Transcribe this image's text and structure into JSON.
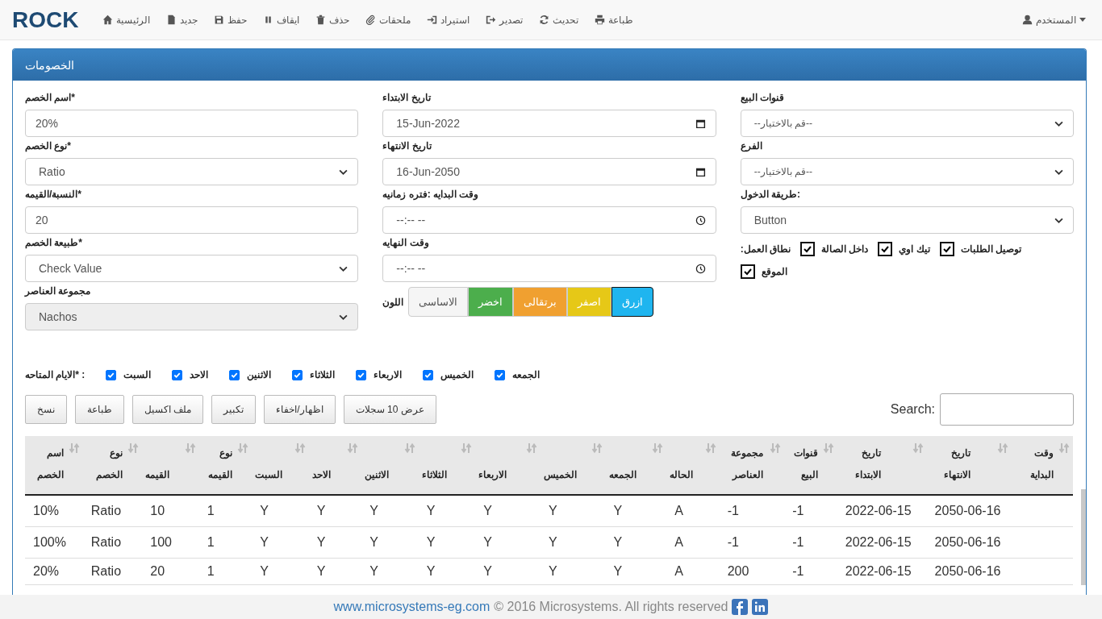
{
  "brand": "ROCK",
  "nav": [
    {
      "label": "طباعة",
      "kind": "print"
    },
    {
      "label": "تحديث",
      "kind": "refresh"
    },
    {
      "label": "تصدير",
      "kind": "export"
    },
    {
      "label": "استيراد",
      "kind": "import"
    },
    {
      "label": "ملحقات",
      "kind": "clip"
    },
    {
      "label": "حذف",
      "kind": "trash"
    },
    {
      "label": "ايقاف",
      "kind": "pause"
    },
    {
      "label": "حفظ",
      "kind": "save"
    },
    {
      "label": "جديد",
      "kind": "file"
    },
    {
      "label": "الرئيسية",
      "kind": "home"
    }
  ],
  "user": {
    "label": "المستخدم"
  },
  "panel": {
    "title": "الخصومات"
  },
  "form_left": [
    {
      "label": "اسم الخصم*",
      "kind": "text",
      "value": "20%"
    },
    {
      "label": "نوع الخصم*",
      "kind": "select",
      "value": "Ratio"
    },
    {
      "label": "النسبة/القيمه*",
      "kind": "text",
      "value": "20"
    },
    {
      "label": "طبيعة الخصم*",
      "kind": "select",
      "value": "Check Value"
    },
    {
      "label": "مجموعة العناصر",
      "kind": "select",
      "value": "Nachos",
      "disabled": true
    }
  ],
  "form_mid": [
    {
      "label": "تاريخ الابتداء",
      "kind": "date",
      "value": "15-Jun-2022"
    },
    {
      "label": "تاريخ الانتهاء",
      "kind": "date",
      "value": "16-Jun-2050"
    },
    {
      "label": "وقت البدايه :فتره زمانيه",
      "kind": "time",
      "value": "--:-- --"
    },
    {
      "label": "وقت النهايه",
      "kind": "time",
      "value": "--:-- --"
    }
  ],
  "color_label": "اللون",
  "colors": [
    {
      "label": "ازرق",
      "color": "#1fb5ef",
      "selected": true
    },
    {
      "label": "اصفر",
      "color": "#e6c817",
      "selected": false
    },
    {
      "label": "برتقالى",
      "color": "#f0a030",
      "selected": false
    },
    {
      "label": "اخضر",
      "color": "#4cae4c",
      "selected": false
    },
    {
      "label": "الاساسى",
      "color": "#f5f5f5",
      "selected": false
    }
  ],
  "form_right": [
    {
      "label": "قنوات البيع",
      "kind": "select",
      "placeholder": "--قم بالاختيار--"
    },
    {
      "label": "الفرع",
      "kind": "select",
      "placeholder": "--قم بالاختيار--"
    },
    {
      "label": "طريقة الدخول:",
      "kind": "select",
      "value": "Button"
    }
  ],
  "scope": {
    "label": ":نطاق العمل",
    "options": [
      {
        "label": "توصيل الطلبات",
        "checked": true
      },
      {
        "label": "تيك اوي",
        "checked": true
      },
      {
        "label": "داخل الصالة",
        "checked": true
      },
      {
        "label": "الموقع",
        "checked": true
      }
    ]
  },
  "days": {
    "label": "الايام المتاحه*  :",
    "items": [
      {
        "label": "الجمعه",
        "checked": true
      },
      {
        "label": "الخميس",
        "checked": true
      },
      {
        "label": "الاربعاء",
        "checked": true
      },
      {
        "label": "الثلاثاء",
        "checked": true
      },
      {
        "label": "الاثنين",
        "checked": true
      },
      {
        "label": "الاحد",
        "checked": true
      },
      {
        "label": "السبت",
        "checked": true
      }
    ]
  },
  "table_buttons": [
    "عرض 10 سجلات",
    "اظهار/اخفاء",
    "تكبير",
    "ملف اكسيل",
    "طباعة",
    "نسخ"
  ],
  "search": {
    "label": "Search:"
  },
  "table": {
    "columns": [
      "وقت البداية",
      "تاريخ الانتهاء",
      "تاريخ الابتداء",
      "قنوات البيع",
      "مجموعة العناصر",
      "الحاله",
      "الجمعه",
      "الخميس",
      "الاربعاء",
      "الثلاثاء",
      "الاثنين",
      "الاحد",
      "السبت",
      "نوع القيمه",
      "القيمه",
      "نوع الخصم",
      "اسم الخصم"
    ],
    "rows": [
      [
        "",
        "2050-06-16",
        "2022-06-15",
        "-1",
        "-1",
        "A",
        "Y",
        "Y",
        "Y",
        "Y",
        "Y",
        "Y",
        "Y",
        "1",
        "10",
        "Ratio",
        "10%"
      ],
      [
        "",
        "2050-06-16",
        "2022-06-15",
        "-1",
        "-1",
        "A",
        "Y",
        "Y",
        "Y",
        "Y",
        "Y",
        "Y",
        "Y",
        "1",
        "100",
        "Ratio",
        "100%"
      ],
      [
        "",
        "2050-06-16",
        "2022-06-15",
        "-1",
        "200",
        "A",
        "Y",
        "Y",
        "Y",
        "Y",
        "Y",
        "Y",
        "Y",
        "1",
        "20",
        "Ratio",
        "20%"
      ]
    ]
  },
  "footer": {
    "link": "www.microsystems-eg.com",
    "text": "© 2016 Microsystems. All rights reserved"
  }
}
